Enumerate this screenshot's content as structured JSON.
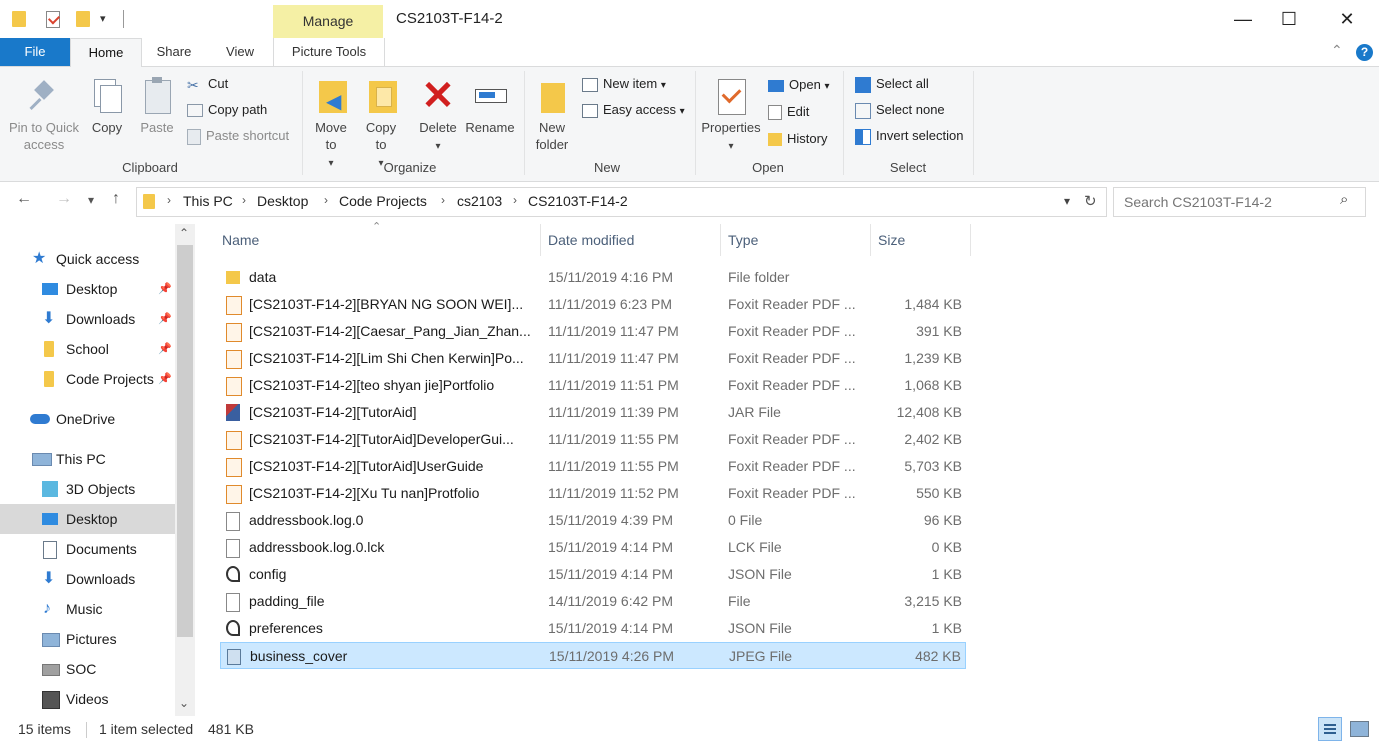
{
  "window": {
    "title": "CS2103T-F14-2",
    "contextual_tab": "Manage",
    "minimize": "—",
    "maximize": "☐",
    "close": "✕"
  },
  "tabs": {
    "file": "File",
    "home": "Home",
    "share": "Share",
    "view": "View",
    "picture_tools": "Picture Tools"
  },
  "ribbon": {
    "clipboard": {
      "pin": "Pin to Quick access",
      "copy": "Copy",
      "paste": "Paste",
      "cut": "Cut",
      "copy_path": "Copy path",
      "paste_shortcut": "Paste shortcut",
      "label": "Clipboard"
    },
    "organize": {
      "move_to": "Move to",
      "copy_to": "Copy to",
      "delete": "Delete",
      "rename": "Rename",
      "label": "Organize"
    },
    "new": {
      "new_folder": "New folder",
      "new_item": "New item",
      "easy_access": "Easy access",
      "label": "New"
    },
    "open": {
      "properties": "Properties",
      "open": "Open",
      "edit": "Edit",
      "history": "History",
      "label": "Open"
    },
    "select": {
      "select_all": "Select all",
      "select_none": "Select none",
      "invert": "Invert selection",
      "label": "Select"
    }
  },
  "address": {
    "crumbs": [
      "This PC",
      "Desktop",
      "Code Projects",
      "cs2103",
      "CS2103T-F14-2"
    ],
    "search_placeholder": "Search CS2103T-F14-2"
  },
  "nav": {
    "quick_access": "Quick access",
    "qa_items": [
      "Desktop",
      "Downloads",
      "School",
      "Code Projects"
    ],
    "onedrive": "OneDrive",
    "this_pc": "This PC",
    "pc_items": [
      "3D Objects",
      "Desktop",
      "Documents",
      "Downloads",
      "Music",
      "Pictures",
      "SOC",
      "Videos"
    ]
  },
  "columns": {
    "name": "Name",
    "date": "Date modified",
    "type": "Type",
    "size": "Size"
  },
  "files": [
    {
      "name": "data",
      "date": "15/11/2019 4:16 PM",
      "type": "File folder",
      "size": "",
      "icon": "folder-icon"
    },
    {
      "name": "[CS2103T-F14-2][BRYAN NG SOON WEI]...",
      "date": "11/11/2019 6:23 PM",
      "type": "Foxit Reader PDF ...",
      "size": "1,484 KB",
      "icon": "pdf-icon"
    },
    {
      "name": "[CS2103T-F14-2][Caesar_Pang_Jian_Zhan...",
      "date": "11/11/2019 11:47 PM",
      "type": "Foxit Reader PDF ...",
      "size": "391 KB",
      "icon": "pdf-icon"
    },
    {
      "name": "[CS2103T-F14-2][Lim Shi Chen Kerwin]Po...",
      "date": "11/11/2019 11:47 PM",
      "type": "Foxit Reader PDF ...",
      "size": "1,239 KB",
      "icon": "pdf-icon"
    },
    {
      "name": "[CS2103T-F14-2][teo shyan jie]Portfolio",
      "date": "11/11/2019 11:51 PM",
      "type": "Foxit Reader PDF ...",
      "size": "1,068 KB",
      "icon": "pdf-icon"
    },
    {
      "name": "[CS2103T-F14-2][TutorAid]",
      "date": "11/11/2019 11:39 PM",
      "type": "JAR File",
      "size": "12,408 KB",
      "icon": "jar-icon"
    },
    {
      "name": "[CS2103T-F14-2][TutorAid]DeveloperGui...",
      "date": "11/11/2019 11:55 PM",
      "type": "Foxit Reader PDF ...",
      "size": "2,402 KB",
      "icon": "pdf-icon"
    },
    {
      "name": "[CS2103T-F14-2][TutorAid]UserGuide",
      "date": "11/11/2019 11:55 PM",
      "type": "Foxit Reader PDF ...",
      "size": "5,703 KB",
      "icon": "pdf-icon"
    },
    {
      "name": "[CS2103T-F14-2][Xu Tu nan]Protfolio",
      "date": "11/11/2019 11:52 PM",
      "type": "Foxit Reader PDF ...",
      "size": "550 KB",
      "icon": "pdf-icon"
    },
    {
      "name": "addressbook.log.0",
      "date": "15/11/2019 4:39 PM",
      "type": "0 File",
      "size": "96 KB",
      "icon": "file-icon"
    },
    {
      "name": "addressbook.log.0.lck",
      "date": "15/11/2019 4:14 PM",
      "type": "LCK File",
      "size": "0 KB",
      "icon": "file-icon"
    },
    {
      "name": "config",
      "date": "15/11/2019 4:14 PM",
      "type": "JSON File",
      "size": "1 KB",
      "icon": "json-icon"
    },
    {
      "name": "padding_file",
      "date": "14/11/2019 6:42 PM",
      "type": "File",
      "size": "3,215 KB",
      "icon": "file-icon"
    },
    {
      "name": "preferences",
      "date": "15/11/2019 4:14 PM",
      "type": "JSON File",
      "size": "1 KB",
      "icon": "json-icon"
    },
    {
      "name": "business_cover",
      "date": "15/11/2019 4:26 PM",
      "type": "JPEG File",
      "size": "482 KB",
      "icon": "jpeg-icon",
      "selected": true
    }
  ],
  "status": {
    "items": "15 items",
    "selected": "1 item selected",
    "size": "481 KB"
  },
  "colors": {
    "accent": "#1979ca",
    "selection": "#cce8ff",
    "manage_tab": "#f5f0a5",
    "folder": "#f4c84a"
  }
}
